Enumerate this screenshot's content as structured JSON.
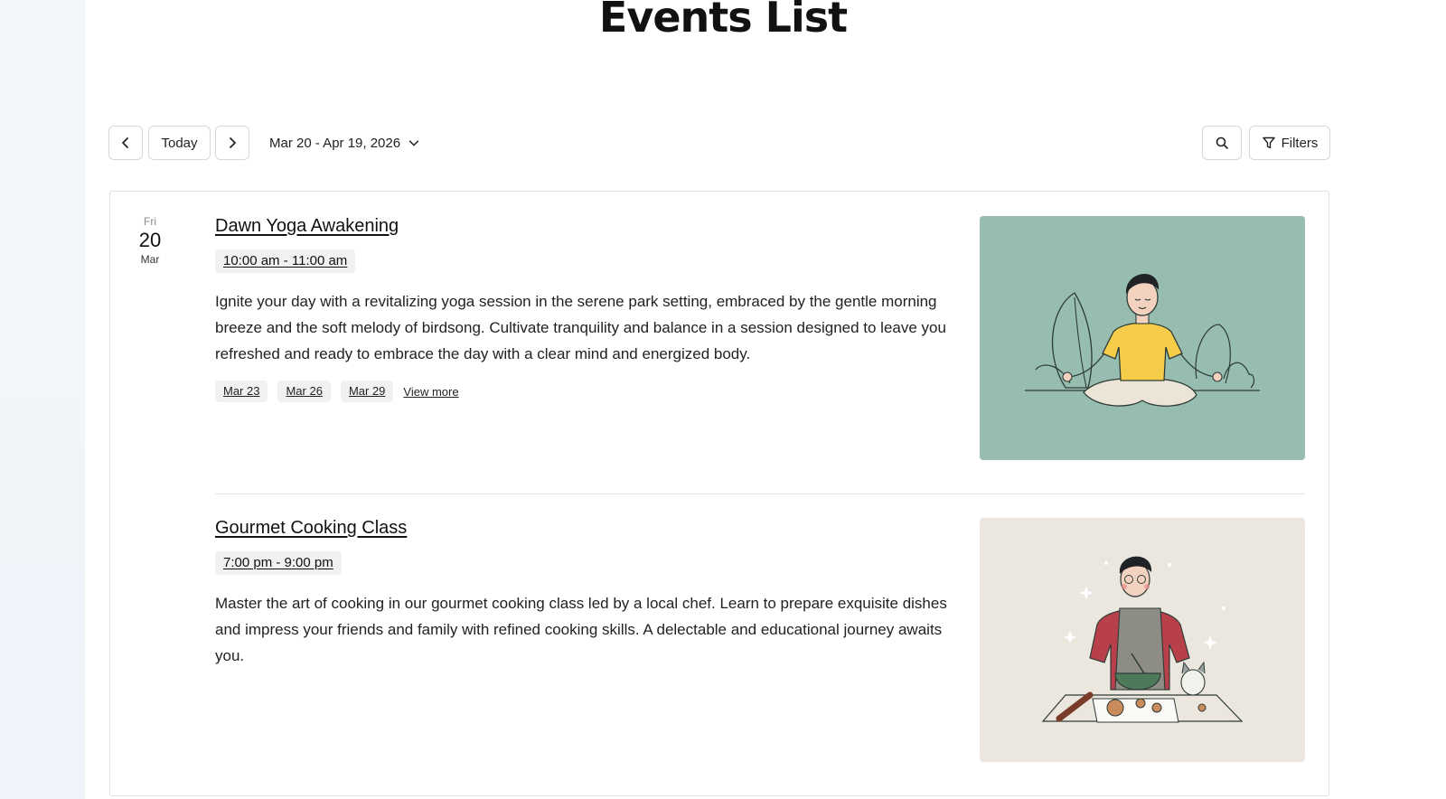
{
  "page": {
    "title": "Events List"
  },
  "toolbar": {
    "prev_icon": "chevron-left-icon",
    "today_label": "Today",
    "next_icon": "chevron-right-icon",
    "date_range": "Mar 20 - Apr 19, 2026",
    "date_range_icon": "chevron-down-icon",
    "search_icon": "search-icon",
    "filters_label": "Filters",
    "filters_icon": "filter-icon"
  },
  "date_group": {
    "dow": "Fri",
    "day": "20",
    "month": "Mar"
  },
  "events": [
    {
      "title": "Dawn Yoga Awakening",
      "time": "10:00 am - 11:00 am",
      "description": "Ignite your day with a revitalizing yoga session in the serene park setting, embraced by the gentle morning breeze and the soft melody of birdsong. Cultivate tranquility and balance in a session designed to leave you refreshed and ready to embrace the day with a clear mind and energized body.",
      "dates": [
        "Mar 23",
        "Mar 26",
        "Mar 29"
      ],
      "view_more": "View more",
      "image_bg": "#97bdb0"
    },
    {
      "title": "Gourmet Cooking Class",
      "time": "7:00 pm - 9:00 pm",
      "description": "Master the art of cooking in our gourmet cooking class led by a local chef. Learn to prepare exquisite dishes and impress your friends and family with refined cooking skills. A delectable and educational journey awaits you.",
      "image_bg": "#ebe7de"
    }
  ]
}
